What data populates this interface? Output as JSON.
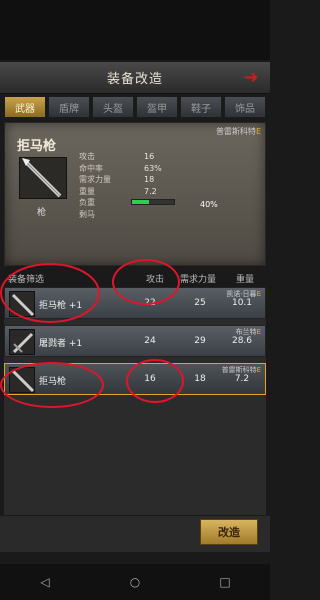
{
  "title": "装备改造",
  "tabs": [
    "武器",
    "盾牌",
    "头盔",
    "盔甲",
    "鞋子",
    "饰品"
  ],
  "active_tab": 0,
  "detail": {
    "name": "拒马枪",
    "type": "枪",
    "quality": "普雷斯科特",
    "quality_grade": "E",
    "stats": [
      {
        "label": "攻击",
        "value": "16"
      },
      {
        "label": "命中率",
        "value": "63%"
      },
      {
        "label": "需求力量",
        "value": "18"
      },
      {
        "label": "重量",
        "value": "7.2"
      }
    ],
    "load_label": "负重",
    "load_value": "40%",
    "load_fraction": 0.4,
    "extra_label": "剩马"
  },
  "list": {
    "filter_label": "装备筛选",
    "col_attack": "攻击",
    "col_strength": "需求力量",
    "col_weight": "重量",
    "items": [
      {
        "name": "拒马枪",
        "level": "+1",
        "attack": "22",
        "strength": "25",
        "weight": "10.1",
        "quality": "凯诺·日暮",
        "grade": "E"
      },
      {
        "name": "屠戮者",
        "level": "+1",
        "attack": "24",
        "strength": "29",
        "weight": "28.6",
        "quality": "布兰特",
        "grade": "E"
      },
      {
        "name": "拒马枪",
        "level": "",
        "attack": "16",
        "strength": "18",
        "weight": "7.2",
        "quality": "普雷斯科特",
        "grade": "E"
      }
    ]
  },
  "upgrade_label": "改造",
  "nav": {
    "back": "◁",
    "home": "○",
    "recent": "□"
  }
}
